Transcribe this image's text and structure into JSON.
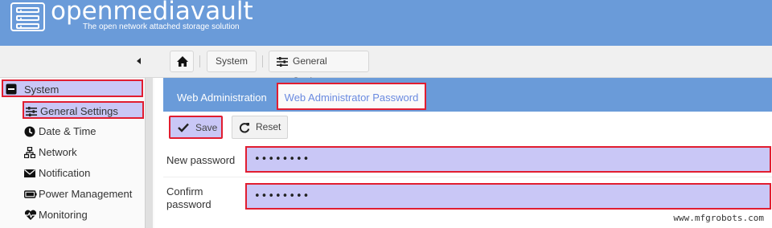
{
  "header": {
    "title": "openmediavault",
    "tagline": "The open network attached storage solution"
  },
  "breadcrumb": {
    "home_icon": "home-icon",
    "system": "System",
    "general_settings": "General Settings"
  },
  "sidebar": {
    "items": [
      {
        "label": "System",
        "icon": "minus-square-icon"
      },
      {
        "label": "General Settings",
        "icon": "sliders-icon"
      },
      {
        "label": "Date & Time",
        "icon": "clock-icon"
      },
      {
        "label": "Network",
        "icon": "network-icon"
      },
      {
        "label": "Notification",
        "icon": "envelope-icon"
      },
      {
        "label": "Power Management",
        "icon": "battery-icon"
      },
      {
        "label": "Monitoring",
        "icon": "heartbeat-icon"
      }
    ]
  },
  "tabs": [
    {
      "label": "Web Administration"
    },
    {
      "label": "Web Administrator Password"
    }
  ],
  "toolbar": {
    "save_label": "Save",
    "reset_label": "Reset"
  },
  "form": {
    "new_password_label": "New password",
    "new_password_value": "••••••••",
    "confirm_password_label": "Confirm password",
    "confirm_password_value": "••••••••"
  },
  "watermark": "www.mfgrobots.com",
  "colors": {
    "header_blue": "#6a9bd9",
    "highlight_fill": "#c9c7f6",
    "highlight_border": "#e11d30"
  }
}
